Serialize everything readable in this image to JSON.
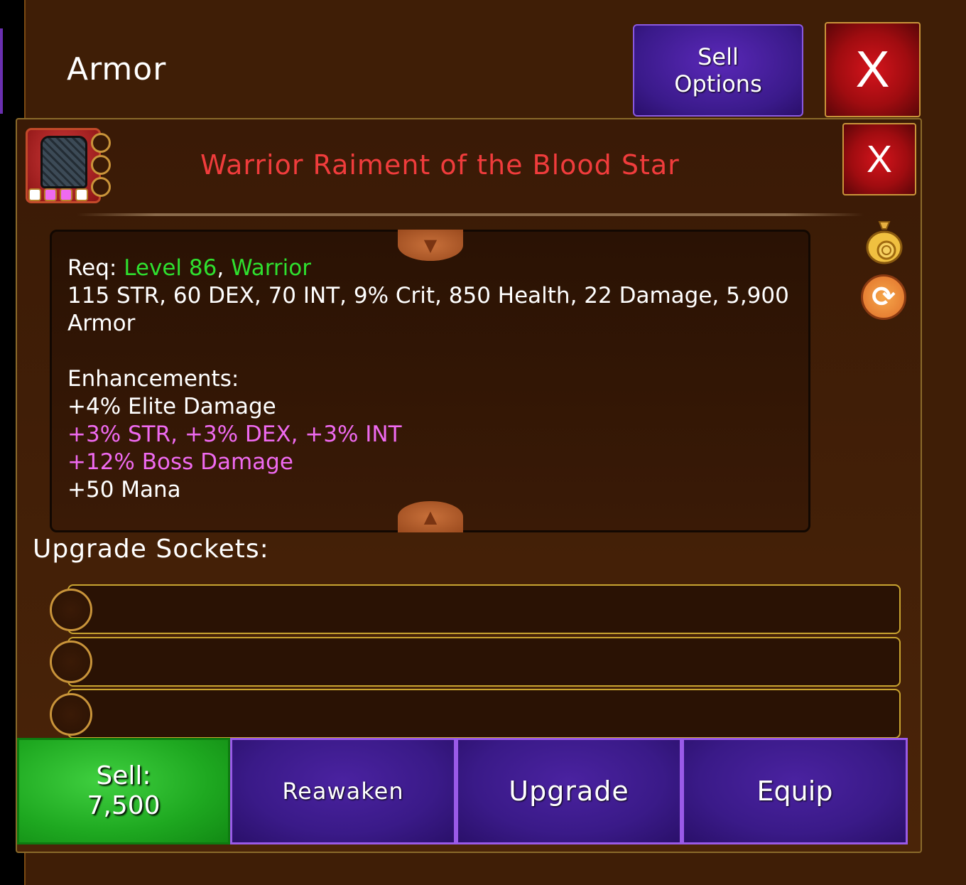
{
  "header": {
    "title": "Armor",
    "sell_options_label": "Sell\nOptions",
    "close_label": "X"
  },
  "item": {
    "name": "Warrior Raiment of the Blood Star",
    "name_color": "#f03c3c",
    "close_label": "X",
    "gem_slots": [
      "#ffffff",
      "#ef6af0",
      "#ef6af0",
      "#ffffff"
    ]
  },
  "stats": {
    "req_label": "Req: ",
    "req_level": "Level 86",
    "req_sep": ", ",
    "req_class": "Warrior",
    "stat_line": "115 STR, 60 DEX, 70 INT, 9% Crit, 850 Health, 22 Damage, 5,900 Armor",
    "enhancements_label": "Enhancements:",
    "enhancements": [
      {
        "text": "+4% Elite Damage",
        "color": "#ffffff"
      },
      {
        "text": "+3% STR, +3% DEX, +3% INT",
        "color": "#ef6af0"
      },
      {
        "text": "+12% Boss Damage",
        "color": "#ef6af0"
      },
      {
        "text": "+50 Mana",
        "color": "#ffffff"
      }
    ]
  },
  "side_icons": [
    "gold-bag-icon",
    "refresh-icon"
  ],
  "sockets": {
    "label": "Upgrade Sockets:",
    "count": 3
  },
  "actions": {
    "sell_label": "Sell:\n7,500",
    "reawaken_label": "Reawaken",
    "upgrade_label": "Upgrade",
    "equip_label": "Equip"
  }
}
